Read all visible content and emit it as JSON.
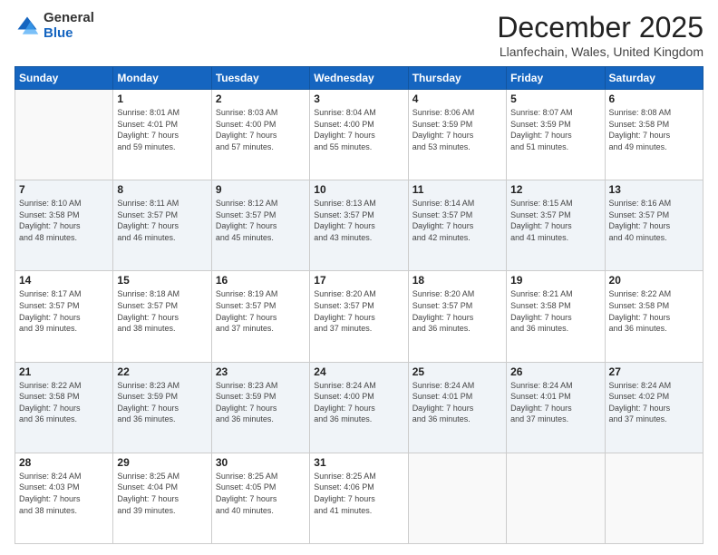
{
  "header": {
    "logo_general": "General",
    "logo_blue": "Blue",
    "month_title": "December 2025",
    "location": "Llanfechain, Wales, United Kingdom"
  },
  "calendar": {
    "days_header": [
      "Sunday",
      "Monday",
      "Tuesday",
      "Wednesday",
      "Thursday",
      "Friday",
      "Saturday"
    ],
    "weeks": [
      [
        {
          "day": "",
          "info": ""
        },
        {
          "day": "1",
          "info": "Sunrise: 8:01 AM\nSunset: 4:01 PM\nDaylight: 7 hours\nand 59 minutes."
        },
        {
          "day": "2",
          "info": "Sunrise: 8:03 AM\nSunset: 4:00 PM\nDaylight: 7 hours\nand 57 minutes."
        },
        {
          "day": "3",
          "info": "Sunrise: 8:04 AM\nSunset: 4:00 PM\nDaylight: 7 hours\nand 55 minutes."
        },
        {
          "day": "4",
          "info": "Sunrise: 8:06 AM\nSunset: 3:59 PM\nDaylight: 7 hours\nand 53 minutes."
        },
        {
          "day": "5",
          "info": "Sunrise: 8:07 AM\nSunset: 3:59 PM\nDaylight: 7 hours\nand 51 minutes."
        },
        {
          "day": "6",
          "info": "Sunrise: 8:08 AM\nSunset: 3:58 PM\nDaylight: 7 hours\nand 49 minutes."
        }
      ],
      [
        {
          "day": "7",
          "info": "Sunrise: 8:10 AM\nSunset: 3:58 PM\nDaylight: 7 hours\nand 48 minutes."
        },
        {
          "day": "8",
          "info": "Sunrise: 8:11 AM\nSunset: 3:57 PM\nDaylight: 7 hours\nand 46 minutes."
        },
        {
          "day": "9",
          "info": "Sunrise: 8:12 AM\nSunset: 3:57 PM\nDaylight: 7 hours\nand 45 minutes."
        },
        {
          "day": "10",
          "info": "Sunrise: 8:13 AM\nSunset: 3:57 PM\nDaylight: 7 hours\nand 43 minutes."
        },
        {
          "day": "11",
          "info": "Sunrise: 8:14 AM\nSunset: 3:57 PM\nDaylight: 7 hours\nand 42 minutes."
        },
        {
          "day": "12",
          "info": "Sunrise: 8:15 AM\nSunset: 3:57 PM\nDaylight: 7 hours\nand 41 minutes."
        },
        {
          "day": "13",
          "info": "Sunrise: 8:16 AM\nSunset: 3:57 PM\nDaylight: 7 hours\nand 40 minutes."
        }
      ],
      [
        {
          "day": "14",
          "info": "Sunrise: 8:17 AM\nSunset: 3:57 PM\nDaylight: 7 hours\nand 39 minutes."
        },
        {
          "day": "15",
          "info": "Sunrise: 8:18 AM\nSunset: 3:57 PM\nDaylight: 7 hours\nand 38 minutes."
        },
        {
          "day": "16",
          "info": "Sunrise: 8:19 AM\nSunset: 3:57 PM\nDaylight: 7 hours\nand 37 minutes."
        },
        {
          "day": "17",
          "info": "Sunrise: 8:20 AM\nSunset: 3:57 PM\nDaylight: 7 hours\nand 37 minutes."
        },
        {
          "day": "18",
          "info": "Sunrise: 8:20 AM\nSunset: 3:57 PM\nDaylight: 7 hours\nand 36 minutes."
        },
        {
          "day": "19",
          "info": "Sunrise: 8:21 AM\nSunset: 3:58 PM\nDaylight: 7 hours\nand 36 minutes."
        },
        {
          "day": "20",
          "info": "Sunrise: 8:22 AM\nSunset: 3:58 PM\nDaylight: 7 hours\nand 36 minutes."
        }
      ],
      [
        {
          "day": "21",
          "info": "Sunrise: 8:22 AM\nSunset: 3:58 PM\nDaylight: 7 hours\nand 36 minutes."
        },
        {
          "day": "22",
          "info": "Sunrise: 8:23 AM\nSunset: 3:59 PM\nDaylight: 7 hours\nand 36 minutes."
        },
        {
          "day": "23",
          "info": "Sunrise: 8:23 AM\nSunset: 3:59 PM\nDaylight: 7 hours\nand 36 minutes."
        },
        {
          "day": "24",
          "info": "Sunrise: 8:24 AM\nSunset: 4:00 PM\nDaylight: 7 hours\nand 36 minutes."
        },
        {
          "day": "25",
          "info": "Sunrise: 8:24 AM\nSunset: 4:01 PM\nDaylight: 7 hours\nand 36 minutes."
        },
        {
          "day": "26",
          "info": "Sunrise: 8:24 AM\nSunset: 4:01 PM\nDaylight: 7 hours\nand 37 minutes."
        },
        {
          "day": "27",
          "info": "Sunrise: 8:24 AM\nSunset: 4:02 PM\nDaylight: 7 hours\nand 37 minutes."
        }
      ],
      [
        {
          "day": "28",
          "info": "Sunrise: 8:24 AM\nSunset: 4:03 PM\nDaylight: 7 hours\nand 38 minutes."
        },
        {
          "day": "29",
          "info": "Sunrise: 8:25 AM\nSunset: 4:04 PM\nDaylight: 7 hours\nand 39 minutes."
        },
        {
          "day": "30",
          "info": "Sunrise: 8:25 AM\nSunset: 4:05 PM\nDaylight: 7 hours\nand 40 minutes."
        },
        {
          "day": "31",
          "info": "Sunrise: 8:25 AM\nSunset: 4:06 PM\nDaylight: 7 hours\nand 41 minutes."
        },
        {
          "day": "",
          "info": ""
        },
        {
          "day": "",
          "info": ""
        },
        {
          "day": "",
          "info": ""
        }
      ]
    ]
  }
}
